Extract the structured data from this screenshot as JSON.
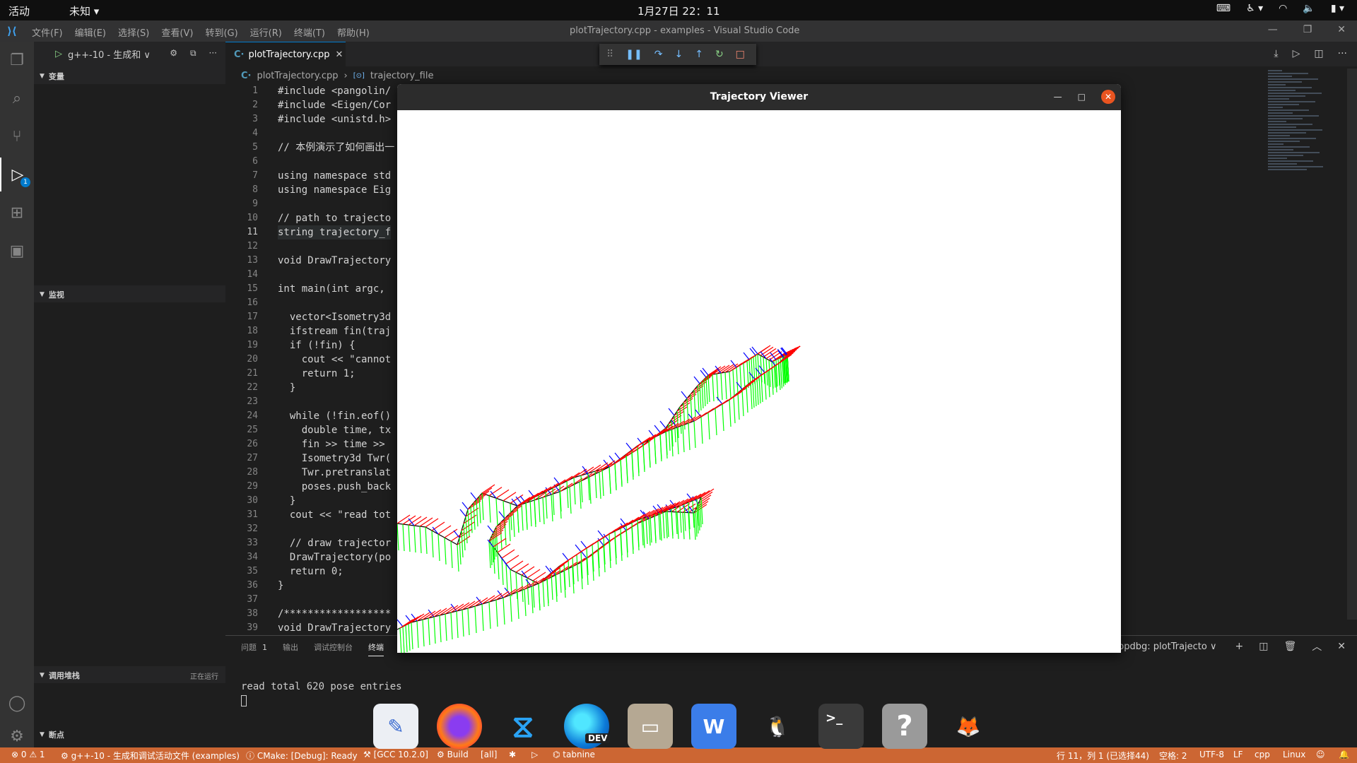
{
  "topbar": {
    "activities": "活动",
    "app_menu": "未知 ▾",
    "clock": "1月27日 22：11"
  },
  "titlebar": {
    "menus": [
      "文件(F)",
      "编辑(E)",
      "选择(S)",
      "查看(V)",
      "转到(G)",
      "运行(R)",
      "终端(T)",
      "帮助(H)"
    ],
    "window_title": "plotTrajectory.cpp - examples - Visual Studio Code"
  },
  "activitybar": {
    "debug_badge": "1"
  },
  "sidebar": {
    "config_label": "g++-10 - 生成和 ∨",
    "sections": {
      "variables": "变量",
      "watch": "监视",
      "callstack": "调用堆栈",
      "callstack_status": "正在运行",
      "breakpoints": "断点"
    }
  },
  "editor": {
    "tab_label": "plotTrajectory.cpp",
    "breadcrumb_file": "plotTrajectory.cpp",
    "breadcrumb_symbol": "trajectory_file",
    "current_line": 11,
    "lines": [
      {
        "n": 1,
        "t": "#include <pangolin/"
      },
      {
        "n": 2,
        "t": "#include <Eigen/Cor"
      },
      {
        "n": 3,
        "t": "#include <unistd.h>"
      },
      {
        "n": 4,
        "t": ""
      },
      {
        "n": 5,
        "t": "// 本例演示了如何画出一"
      },
      {
        "n": 6,
        "t": ""
      },
      {
        "n": 7,
        "t": "using namespace std"
      },
      {
        "n": 8,
        "t": "using namespace Eig"
      },
      {
        "n": 9,
        "t": ""
      },
      {
        "n": 10,
        "t": "// path to trajecto"
      },
      {
        "n": 11,
        "t": "string trajectory_f"
      },
      {
        "n": 12,
        "t": ""
      },
      {
        "n": 13,
        "t": "void DrawTrajectory"
      },
      {
        "n": 14,
        "t": ""
      },
      {
        "n": 15,
        "t": "int main(int argc, "
      },
      {
        "n": 16,
        "t": ""
      },
      {
        "n": 17,
        "t": "  vector<Isometry3d"
      },
      {
        "n": 18,
        "t": "  ifstream fin(traj"
      },
      {
        "n": 19,
        "t": "  if (!fin) {"
      },
      {
        "n": 20,
        "t": "    cout << \"cannot"
      },
      {
        "n": 21,
        "t": "    return 1;"
      },
      {
        "n": 22,
        "t": "  }"
      },
      {
        "n": 23,
        "t": ""
      },
      {
        "n": 24,
        "t": "  while (!fin.eof()"
      },
      {
        "n": 25,
        "t": "    double time, tx"
      },
      {
        "n": 26,
        "t": "    fin >> time >> "
      },
      {
        "n": 27,
        "t": "    Isometry3d Twr("
      },
      {
        "n": 28,
        "t": "    Twr.pretranslat"
      },
      {
        "n": 29,
        "t": "    poses.push_back"
      },
      {
        "n": 30,
        "t": "  }"
      },
      {
        "n": 31,
        "t": "  cout << \"read tot"
      },
      {
        "n": 32,
        "t": ""
      },
      {
        "n": 33,
        "t": "  // draw trajector"
      },
      {
        "n": 34,
        "t": "  DrawTrajectory(po"
      },
      {
        "n": 35,
        "t": "  return 0;"
      },
      {
        "n": 36,
        "t": "}"
      },
      {
        "n": 37,
        "t": ""
      },
      {
        "n": 38,
        "t": "/******************"
      },
      {
        "n": 39,
        "t": "void DrawTrajectory"
      }
    ]
  },
  "panel": {
    "tabs": [
      "问题",
      "输出",
      "调试控制台",
      "终端"
    ],
    "problems_count": "1",
    "terminal_select": "cppdbg: plotTrajecto ∨",
    "terminal_output": "read total 620 pose entries"
  },
  "viewer": {
    "title": "Trajectory Viewer",
    "trajectory_colors": {
      "x_axis": "#ff0000",
      "y_axis": "#00ff00",
      "z_axis": "#0000ff",
      "path": "#000000"
    }
  },
  "dock": {
    "apps": [
      "text-editor",
      "firefox",
      "vscode",
      "edge-dev",
      "files",
      "wps-writer",
      "qq",
      "terminal",
      "help",
      "gimp"
    ],
    "edge_label": "DEV"
  },
  "statusbar": {
    "errors": "⊗ 0 ⚠ 1",
    "debug_config": "g++-10 - 生成和调试活动文件 (examples)",
    "cmake": "CMake: [Debug]: Ready",
    "compiler": "[GCC 10.2.0]",
    "build": "Build",
    "target": "[all]",
    "tabnine": "tabnine",
    "cursor": "行 11，列 1 (已选择44)",
    "spaces": "空格: 2",
    "encoding": "UTF-8",
    "eol": "LF",
    "language": "cpp",
    "os": "Linux"
  }
}
